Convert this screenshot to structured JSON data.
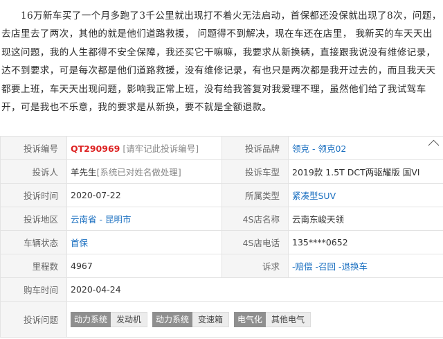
{
  "description": "16万新车买了一个月多跑了3千公里就出现打不着火无法启动，首保都还没保就出现了8次，问题，去店里去了两次，其他的就是他们道路救援， 问题得不到解决，现在车还在店里， 我新买的车天天出现这问题，我的人生都得不安全保障，我还买它干嘛嘛，我要求从新换辆，直接跟我说没有维修记录，达不到要求，可是每次都是他们道路救援，没有维修记录，有也只是两次都是我开过去的，而且我天天都要上班，车天天出现问题，影响我正常上班，没有给我答复对我爱理不理，虽然他们给了我试驾车开，可是我也不乐意，我的要求是从新换，要不就是全额退款。",
  "labels": {
    "complaint_no": "投诉编号",
    "brand": "投诉品牌",
    "complainant": "投诉人",
    "model": "投诉车型",
    "time": "投诉时间",
    "type": "所属类型",
    "region": "投诉地区",
    "dealer": "4S店名称",
    "status": "车辆状态",
    "phone": "4S店电话",
    "mileage": "里程数",
    "demand": "诉求",
    "purchase": "购车时间",
    "issue": "投诉问题"
  },
  "values": {
    "complaint_no": "QT290969",
    "complaint_no_note": "[请牢记此投诉编号]",
    "brand": "领克 - 领克02",
    "complainant": "羊先生",
    "complainant_note": "[系统已对姓名做处理]",
    "model": "2019款 1.5T DCT两驱耀版 国VI",
    "time": "2020-07-22",
    "type": "紧凑型SUV",
    "region": "云南省 - 昆明市",
    "dealer": "云南东峻天领",
    "status": "首保",
    "phone": "135****0652",
    "mileage": "4967",
    "demand": "-赔偿 -召回 -退换车",
    "purchase": "2020-04-24"
  },
  "issues": [
    {
      "k": "动力系统",
      "v": "发动机"
    },
    {
      "k": "动力系统",
      "v": "变速箱"
    },
    {
      "k": "电气化",
      "v": "其他电气"
    }
  ],
  "icons": {
    "collapse": "chevron-up-icon"
  }
}
